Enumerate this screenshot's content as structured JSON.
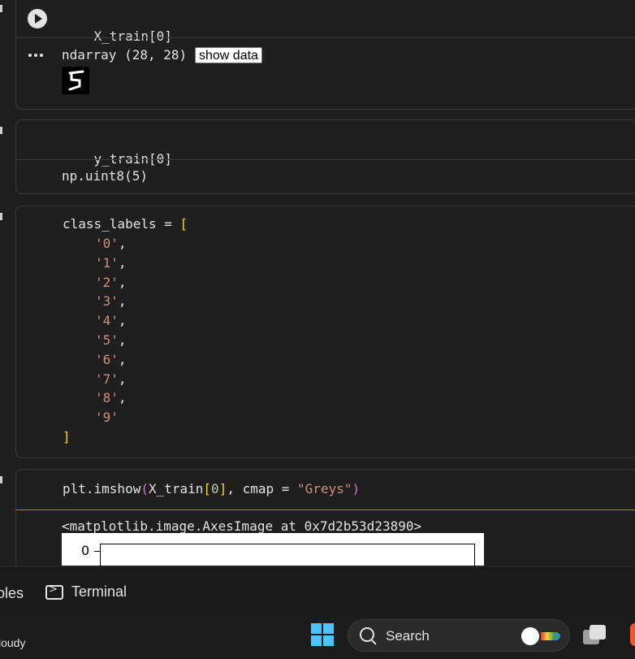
{
  "cells": [
    {
      "code": "X_train[0]",
      "output_type": "ndarray (28, 28)",
      "show_data_label": "show data"
    },
    {
      "code": "y_train[0]",
      "output": "np.uint8(5)"
    },
    {
      "code_head": "class_labels = ",
      "labels": [
        "'0',",
        "'1',",
        "'2',",
        "'3',",
        "'4',",
        "'5',",
        "'6',",
        "'7',",
        "'8',",
        "'9'"
      ],
      "open_bracket": "[",
      "close_bracket": "]"
    },
    {
      "code_fn": "plt.imshow",
      "code_arg": "X_train",
      "code_idx": "0",
      "code_kw": ", cmap = ",
      "code_str": "\"Greys\"",
      "output": "<matplotlib.image.AxesImage at 0x7d2b53d23890>",
      "tick_label": "0"
    }
  ],
  "panel": {
    "variables_tab": "oles",
    "terminal_tab": "Terminal"
  },
  "taskbar": {
    "weather": "loudy",
    "search_label": "Search"
  },
  "colors": {
    "string": "#ce9178",
    "bracket": "#ffd700",
    "number": "#b5cea8",
    "accent": "#4cc2ff"
  }
}
